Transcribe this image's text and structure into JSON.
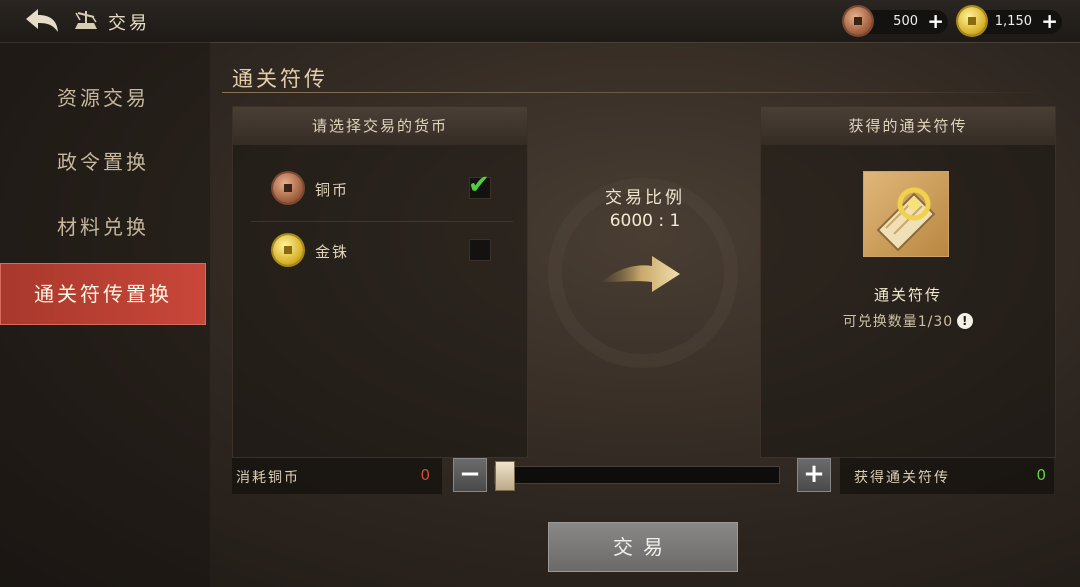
{
  "header": {
    "title": "交易",
    "currencies": [
      {
        "name": "copper-coin",
        "value": "500"
      },
      {
        "name": "gold-coin",
        "value": "1,150"
      }
    ]
  },
  "nav": {
    "items": [
      {
        "label": "资源交易",
        "active": false
      },
      {
        "label": "政令置换",
        "active": false
      },
      {
        "label": "材料兑换",
        "active": false
      },
      {
        "label": "通关符传置换",
        "active": true
      }
    ]
  },
  "section": {
    "title": "通关符传"
  },
  "select_panel": {
    "title": "请选择交易的货币",
    "options": [
      {
        "label": "铜币",
        "checked": true,
        "icon": "copper-coin-icon"
      },
      {
        "label": "金铢",
        "checked": false,
        "icon": "gold-coin-icon"
      }
    ]
  },
  "ratio": {
    "label": "交易比例",
    "value": "6000 : 1"
  },
  "result_panel": {
    "title": "获得的通关符传",
    "item_name": "通关符传",
    "limit_text": "可兑换数量1/30",
    "info_glyph": "!"
  },
  "bottom": {
    "cost_label": "消耗铜币",
    "cost_value": "0",
    "gain_label": "获得通关符传",
    "gain_value": "0",
    "minus": "−",
    "plus": "+",
    "slider_level": 0
  },
  "trade_button": "交易",
  "colors": {
    "active_tab": "#c9473a",
    "cost": "#d44a3a",
    "gain": "#64d04c",
    "check": "#4fcf3c"
  }
}
